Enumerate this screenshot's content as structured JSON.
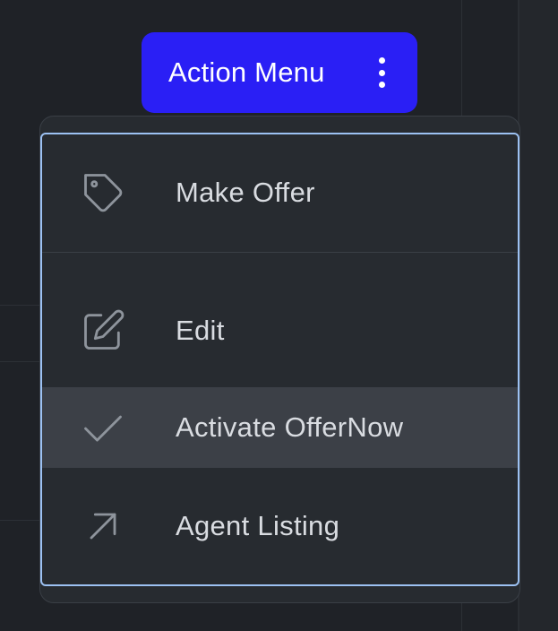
{
  "trigger": {
    "label": "Action Menu",
    "icon": "kebab-icon"
  },
  "menu": {
    "items": [
      {
        "label": "Make Offer",
        "icon": "tag-icon",
        "highlighted": false
      },
      {
        "label": "Edit",
        "icon": "edit-icon",
        "highlighted": false
      },
      {
        "label": "Activate OfferNow",
        "icon": "check-icon",
        "highlighted": true
      },
      {
        "label": "Agent Listing",
        "icon": "arrow-up-right-icon",
        "highlighted": false
      }
    ]
  },
  "colors": {
    "background": "#1f2227",
    "button": "#2a1ff5",
    "menu_background": "#272b30",
    "focus_ring": "#9cc1f2",
    "highlight": "#3c4047",
    "text": "#d9dce1",
    "icon": "#8e949c"
  }
}
